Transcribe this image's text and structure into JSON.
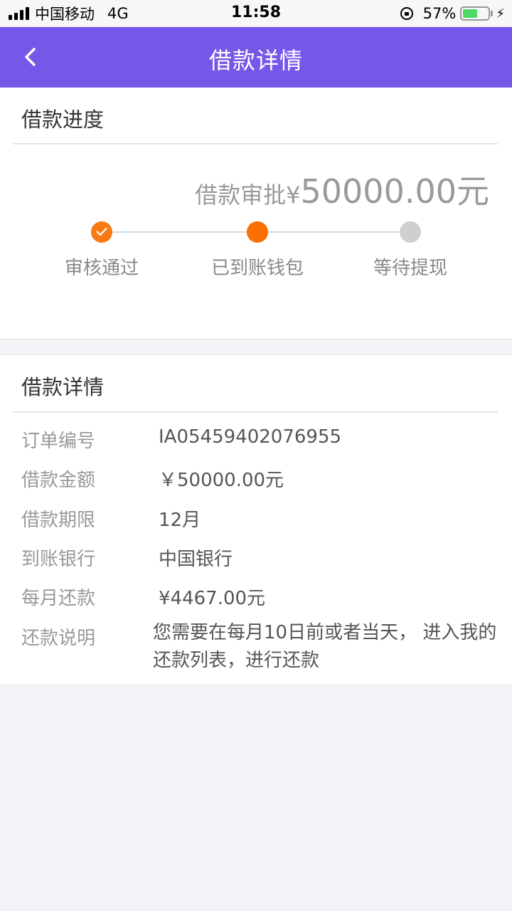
{
  "status_bar": {
    "carrier": "中国移动",
    "network": "4G",
    "time": "11:58",
    "battery_percent": "57%",
    "battery_level": 0.57
  },
  "nav": {
    "back_icon": "chevron-left-icon",
    "title": "借款详情"
  },
  "progress": {
    "title": "借款进度",
    "amount_label": "借款审批¥",
    "amount_value": "50000.00元",
    "steps": [
      {
        "label": "审核通过",
        "state": "done"
      },
      {
        "label": "已到账钱包",
        "state": "current"
      },
      {
        "label": "等待提现",
        "state": "pending"
      }
    ]
  },
  "detail": {
    "title": "借款详情",
    "rows": [
      {
        "label": "订单编号",
        "value": "IA05459402076955"
      },
      {
        "label": "借款金额",
        "value": "￥50000.00元"
      },
      {
        "label": "借款期限",
        "value": "12月"
      },
      {
        "label": "到账银行",
        "value": "中国银行"
      },
      {
        "label": "每月还款",
        "value": "¥4467.00元"
      },
      {
        "label": "还款说明",
        "value": "您需要在每月10日前或者当天， 进入我的还款列表，进行还款"
      }
    ]
  },
  "colors": {
    "nav_bg": "#7558e8",
    "step_active": "#fb6f00",
    "step_pending": "#cfcfcf",
    "page_bg": "#f2f2f7"
  }
}
